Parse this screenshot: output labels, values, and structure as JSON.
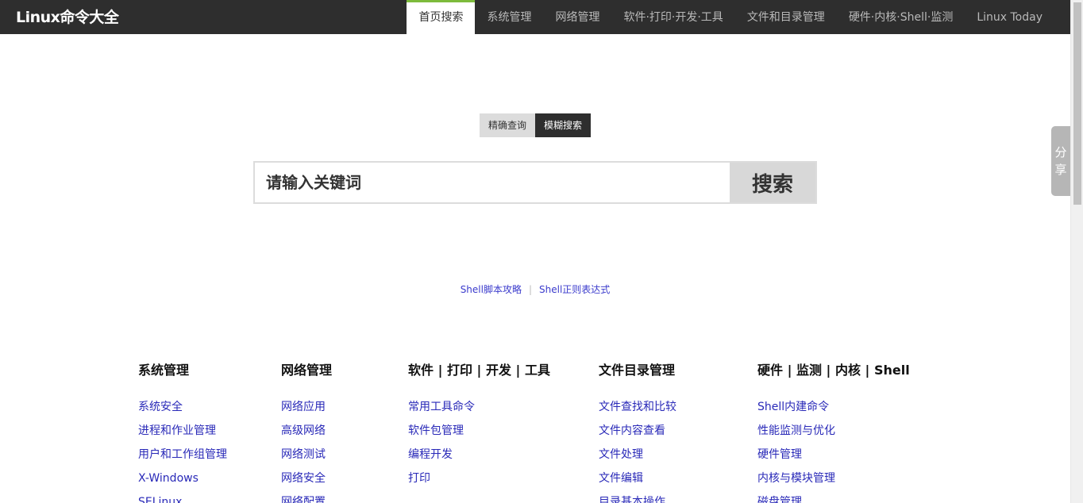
{
  "header": {
    "logo": "Linux命令大全",
    "nav": [
      {
        "label": "首页搜索",
        "active": true
      },
      {
        "label": "系统管理",
        "active": false
      },
      {
        "label": "网络管理",
        "active": false
      },
      {
        "label": "软件·打印·开发·工具",
        "active": false
      },
      {
        "label": "文件和目录管理",
        "active": false
      },
      {
        "label": "硬件·内核·Shell·监测",
        "active": false
      },
      {
        "label": "Linux Today",
        "active": false
      }
    ]
  },
  "share": {
    "line1": "分",
    "line2": "享"
  },
  "search": {
    "mode_exact": "精确查询",
    "mode_fuzzy": "模糊搜索",
    "placeholder": "请输入关键词",
    "button": "搜索"
  },
  "quick_links": {
    "link1": "Shell脚本攻略",
    "separator": "|",
    "link2": "Shell正则表达式"
  },
  "categories": [
    {
      "title": "系统管理",
      "items": [
        "系统安全",
        "进程和作业管理",
        "用户和工作组管理",
        "X-Windows",
        "SELinux"
      ]
    },
    {
      "title": "网络管理",
      "items": [
        "网络应用",
        "高级网络",
        "网络测试",
        "网络安全",
        "网络配置"
      ]
    },
    {
      "title": "软件 | 打印 | 开发 | 工具",
      "items": [
        "常用工具命令",
        "软件包管理",
        "编程开发",
        "打印"
      ]
    },
    {
      "title": "文件目录管理",
      "items": [
        "文件查找和比较",
        "文件内容查看",
        "文件处理",
        "文件编辑",
        "目录基本操作"
      ]
    },
    {
      "title": "硬件 | 监测 | 内核 | Shell",
      "items": [
        "Shell内建命令",
        "性能监测与优化",
        "硬件管理",
        "内核与模块管理",
        "磁盘管理"
      ]
    }
  ],
  "colors": {
    "topbar_bg": "#2e2e2e",
    "active_accent": "#7dbb3c",
    "link": "#2929b8"
  }
}
